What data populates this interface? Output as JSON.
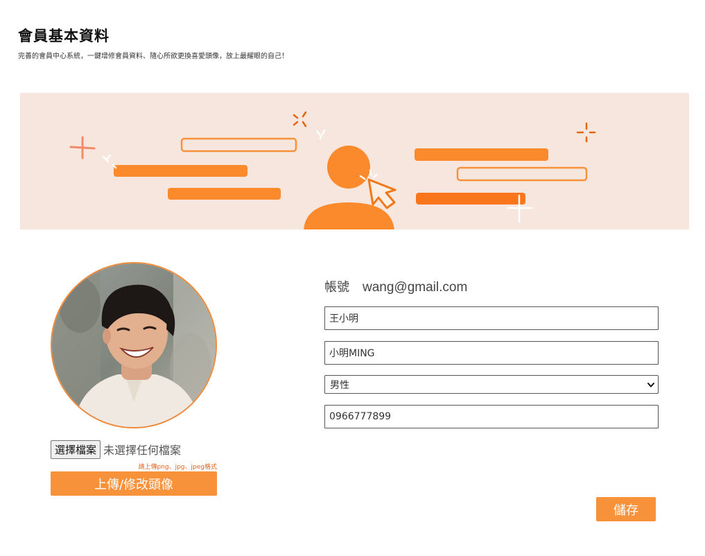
{
  "header": {
    "title": "會員基本資料",
    "subtitle": "完善的會員中心系統，一鍵增修會員資料、隨心所欲更換喜愛頭像，放上最耀眼的自己！"
  },
  "avatar_panel": {
    "file_button_label": "選擇檔案",
    "file_status": "未選擇任何檔案",
    "format_hint": "請上傳png、jpg、jpeg格式",
    "upload_button_label": "上傳/修改頭像"
  },
  "profile_form": {
    "account_label": "帳號",
    "account_value": "wang@gmail.com",
    "name_value": "王小明",
    "nickname_value": "小明MING",
    "gender_value": "男性",
    "phone_value": "0966777899",
    "save_button_label": "儲存"
  },
  "colors": {
    "accent": "#f7913a",
    "accent_dark": "#f0781a",
    "banner_bg": "#f6e6de",
    "hint_text": "#e0621b"
  },
  "icons": {
    "banner": "user-profile-illustration",
    "cursor": "pointer-cursor-icon",
    "select": "chevron-down-icon"
  }
}
